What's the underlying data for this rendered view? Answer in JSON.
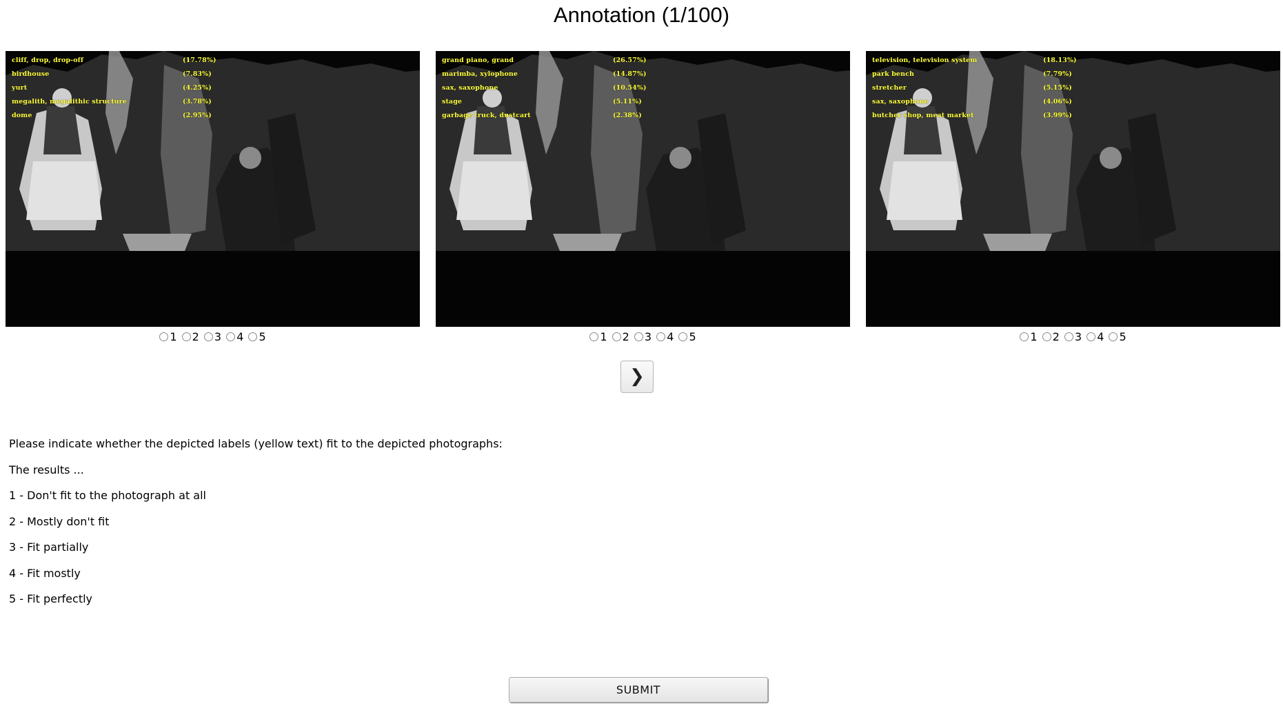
{
  "page": {
    "title": "Annotation (1/100)"
  },
  "images": [
    {
      "labels": [
        {
          "name": "cliff, drop, drop-off",
          "pct": "(17.78%)"
        },
        {
          "name": "birdhouse",
          "pct": "(7.83%)"
        },
        {
          "name": "yurt",
          "pct": "(4.25%)"
        },
        {
          "name": "megalith, megalithic structure",
          "pct": "(3.78%)"
        },
        {
          "name": "dome",
          "pct": "(2.95%)"
        }
      ],
      "rating_options": [
        "1",
        "2",
        "3",
        "4",
        "5"
      ]
    },
    {
      "labels": [
        {
          "name": "grand piano, grand",
          "pct": "(26.57%)"
        },
        {
          "name": "marimba, xylophone",
          "pct": "(14.87%)"
        },
        {
          "name": "sax, saxophone",
          "pct": "(10.54%)"
        },
        {
          "name": "stage",
          "pct": "(5.11%)"
        },
        {
          "name": "garbage truck, dustcart",
          "pct": "(2.38%)"
        }
      ],
      "rating_options": [
        "1",
        "2",
        "3",
        "4",
        "5"
      ]
    },
    {
      "labels": [
        {
          "name": "television, television system",
          "pct": "(18.13%)"
        },
        {
          "name": "park bench",
          "pct": "(7.79%)"
        },
        {
          "name": "stretcher",
          "pct": "(5.15%)"
        },
        {
          "name": "sax, saxophone",
          "pct": "(4.06%)"
        },
        {
          "name": "butcher shop, meat market",
          "pct": "(3.99%)"
        }
      ],
      "rating_options": [
        "1",
        "2",
        "3",
        "4",
        "5"
      ]
    }
  ],
  "next_button": {
    "icon": "chevron-right-icon",
    "glyph": "❯"
  },
  "instructions": {
    "intro": "Please indicate whether the depicted labels (yellow text) fit to the depicted photographs:",
    "lead": "The results ...",
    "scale": [
      "1 - Don't fit to the photograph at all",
      "2 - Mostly don't fit",
      "3 - Fit partially",
      "4 - Fit mostly",
      "5 - Fit perfectly"
    ]
  },
  "submit": {
    "label": "SUBMIT"
  },
  "colors": {
    "label_text": "#ffff3b",
    "photo_background": "#070707"
  }
}
